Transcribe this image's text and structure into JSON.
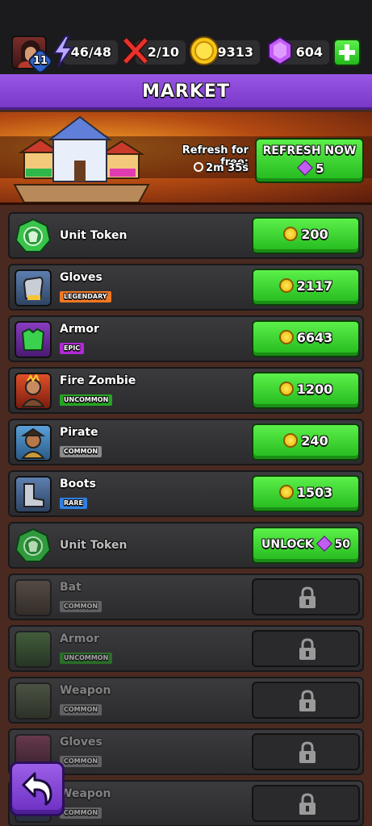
{
  "resources": {
    "level": "11",
    "energy": "46/48",
    "battles": "2/10",
    "coins": "9313",
    "gems": "604"
  },
  "title": "MARKET",
  "banner": {
    "refresh_label": "Refresh for free:",
    "timer": "2m 35s",
    "refresh_button": "REFRESH NOW",
    "refresh_cost": "5"
  },
  "items": [
    {
      "name": "Unit Token",
      "rarity": "",
      "price": "200",
      "state": "buy"
    },
    {
      "name": "Gloves",
      "rarity": "LEGENDARY",
      "price": "2117",
      "state": "buy"
    },
    {
      "name": "Armor",
      "rarity": "EPIC",
      "price": "6643",
      "state": "buy"
    },
    {
      "name": "Fire Zombie",
      "rarity": "UNCOMMON",
      "price": "1200",
      "state": "buy"
    },
    {
      "name": "Pirate",
      "rarity": "COMMON",
      "price": "240",
      "state": "buy"
    },
    {
      "name": "Boots",
      "rarity": "RARE",
      "price": "1503",
      "state": "buy"
    },
    {
      "name": "Unit Token",
      "rarity": "",
      "price": "50",
      "state": "unlock",
      "button_label": "UNLOCK"
    },
    {
      "name": "Bat",
      "rarity": "COMMON",
      "state": "locked"
    },
    {
      "name": "Armor",
      "rarity": "UNCOMMON",
      "state": "locked"
    },
    {
      "name": "Weapon",
      "rarity": "COMMON",
      "state": "locked"
    },
    {
      "name": "Gloves",
      "rarity": "COMMON",
      "state": "locked"
    },
    {
      "name": "Weapon",
      "rarity": "COMMON",
      "state": "locked"
    }
  ],
  "colors": {
    "green_button": "#23b81d",
    "purple_header": "#8a45d8",
    "legendary": "#f07820",
    "epic": "#b22ad6",
    "uncommon": "#25a521",
    "common": "#8a8a8a",
    "rare": "#2f7fe0"
  }
}
